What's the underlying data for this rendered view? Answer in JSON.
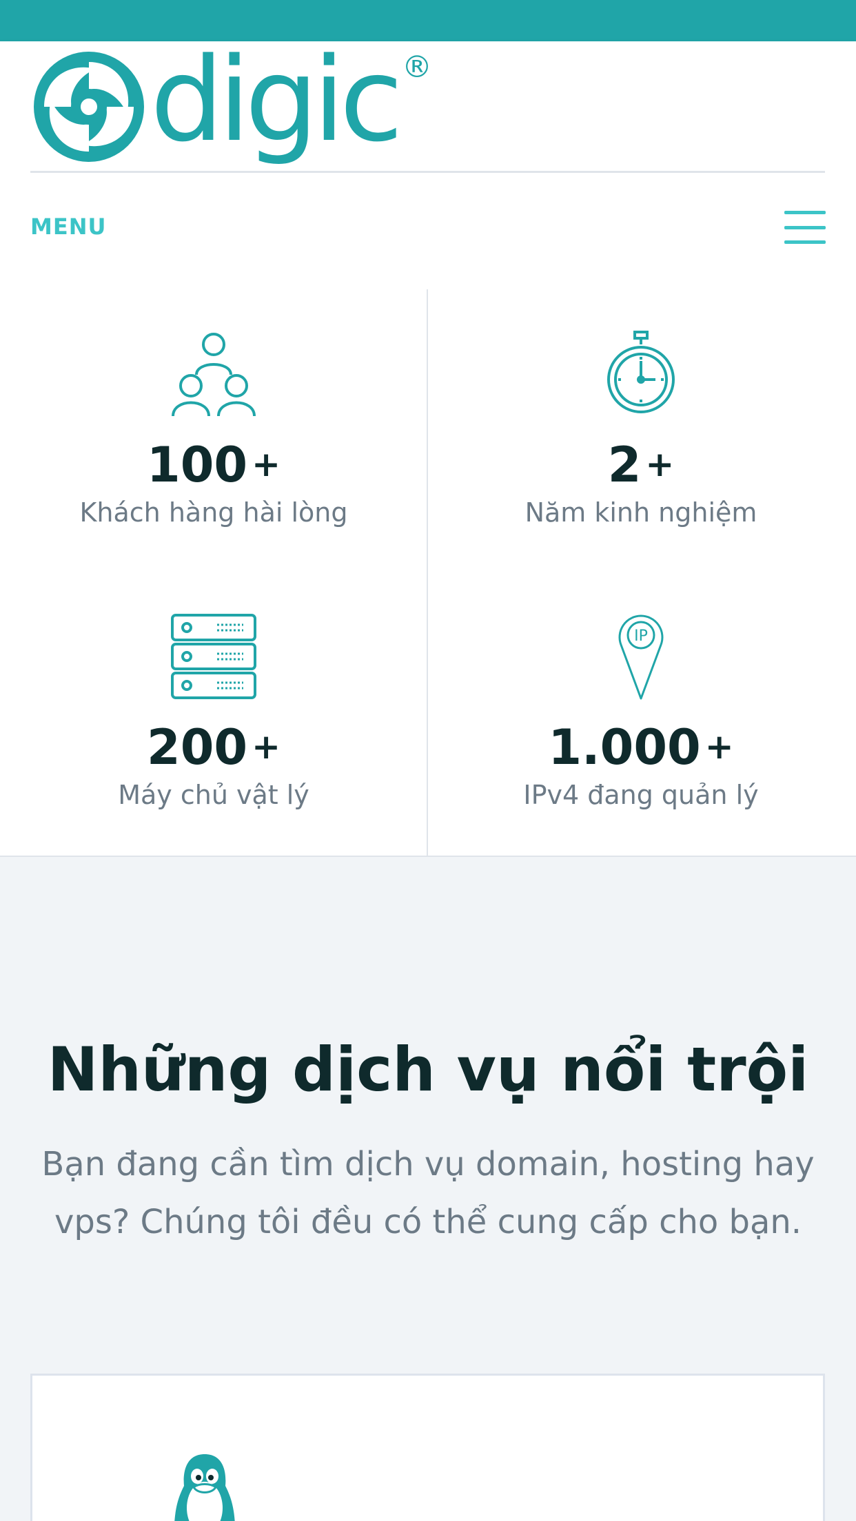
{
  "brand": {
    "name": "digic",
    "registered": "®",
    "color": "#20a5a8"
  },
  "nav": {
    "menu_label": "MENU",
    "menu_icon": "hamburger-icon"
  },
  "stats": [
    {
      "icon": "users-icon",
      "number": "100",
      "suffix": "+",
      "label": "Khách hàng hài lòng"
    },
    {
      "icon": "stopwatch-icon",
      "number": "2",
      "suffix": "+",
      "label": "Năm kinh nghiệm"
    },
    {
      "icon": "server-icon",
      "number": "200",
      "suffix": "+",
      "label": "Máy chủ vật lý"
    },
    {
      "icon": "ip-pin-icon",
      "number": "1.000",
      "suffix": "+",
      "label": "IPv4 đang quản lý"
    }
  ],
  "services": {
    "title": "Những dịch vụ nổi trội",
    "subtitle": "Bạn đang cần tìm dịch vụ domain, hosting hay vps? Chúng tôi đều có thể cung cấp cho bạn.",
    "first_card_icon": "linux-tux-icon"
  },
  "colors": {
    "accent": "#20a5a8",
    "menu": "#3cc4c7",
    "heading": "#0f2a2c",
    "muted": "#6c7a86",
    "background": "#f1f4f7"
  }
}
